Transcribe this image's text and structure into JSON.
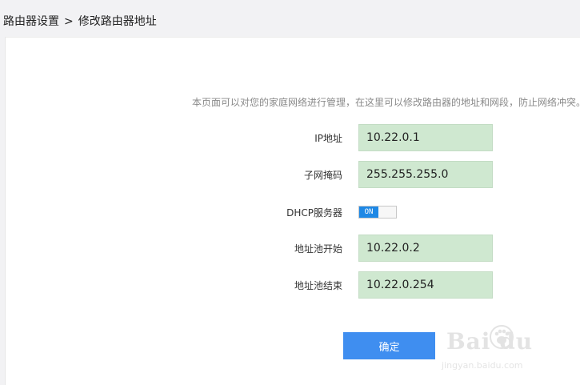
{
  "breadcrumb": {
    "parent": "路由器设置",
    "separator": ">",
    "current": "修改路由器地址"
  },
  "description": "本页面可以对您的家庭网络进行管理，在这里可以修改路由器的地址和网段，防止网络冲突。",
  "form": {
    "ip_label": "IP地址",
    "ip_value": "10.22.0.1",
    "mask_label": "子网掩码",
    "mask_value": "255.255.255.0",
    "dhcp_label": "DHCP服务器",
    "dhcp_state": "ON",
    "pool_start_label": "地址池开始",
    "pool_start_value": "10.22.0.2",
    "pool_end_label": "地址池结束",
    "pool_end_value": "10.22.0.254"
  },
  "confirm_label": "确定",
  "watermark": {
    "title": "Baidu经验",
    "url": "jingyan.baidu.com"
  },
  "colors": {
    "accent": "#3f8ef0",
    "toggle_on": "#1e88e5",
    "field_bg": "#cfe8d0"
  }
}
